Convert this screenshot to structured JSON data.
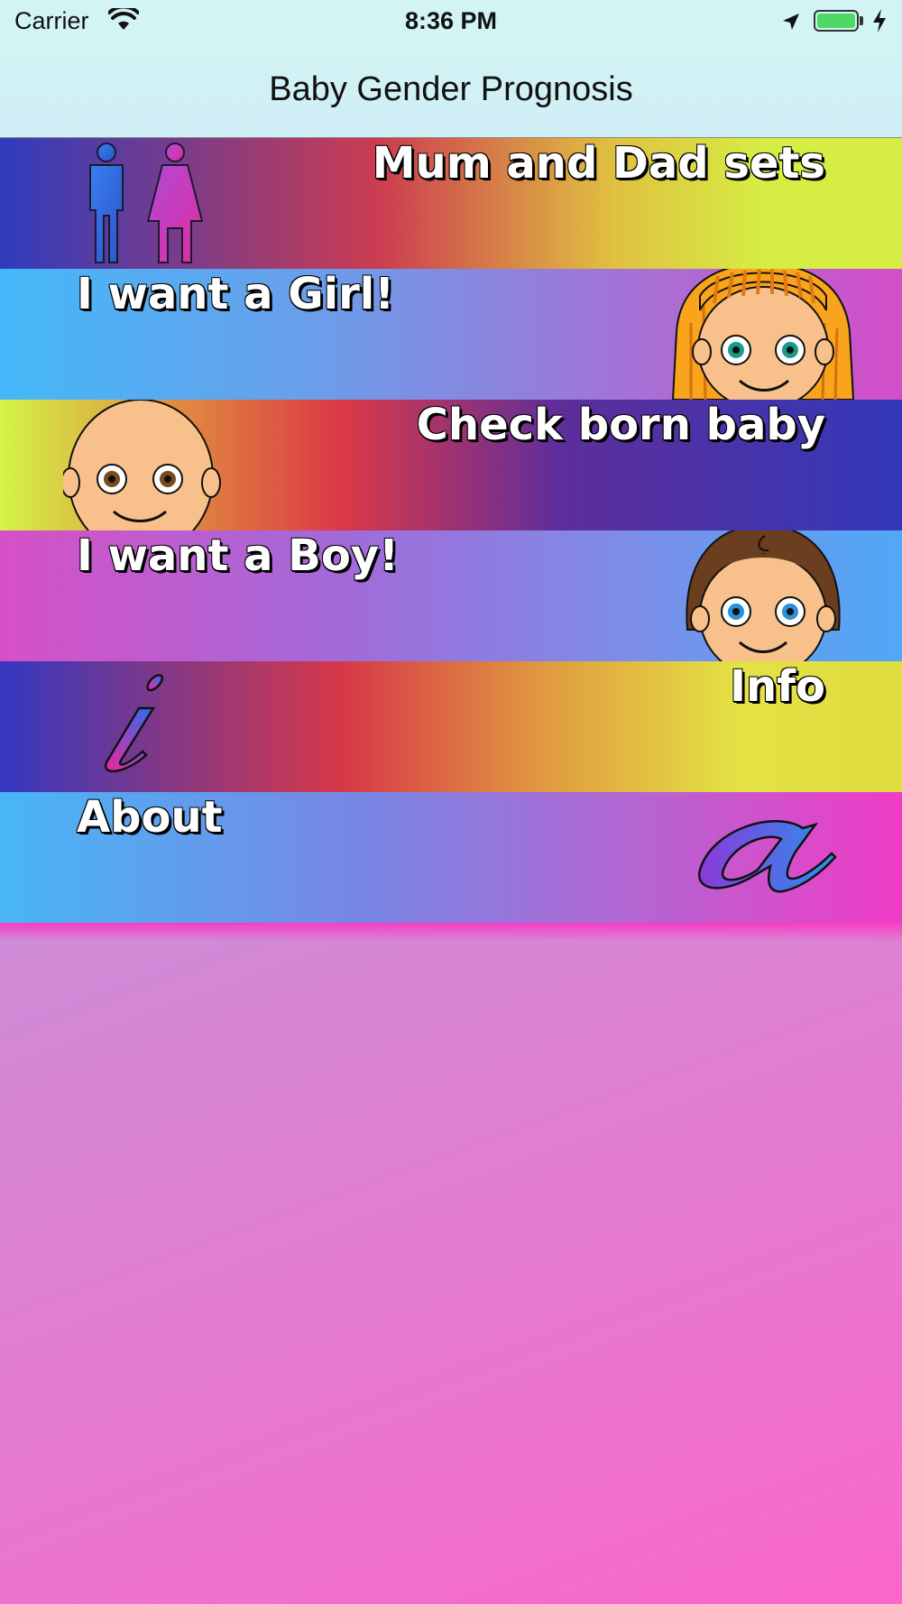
{
  "status_bar": {
    "carrier": "Carrier",
    "time": "8:36 PM",
    "battery_color": "#4cd964"
  },
  "nav": {
    "title": "Baby Gender Prognosis"
  },
  "menu": {
    "items": [
      {
        "label": "Mum and Dad sets",
        "icon": "parents-icon"
      },
      {
        "label": "I want a Girl!",
        "icon": "girl-face-icon"
      },
      {
        "label": "Check born baby",
        "icon": "baby-face-icon"
      },
      {
        "label": "I want a Boy!",
        "icon": "boy-face-icon"
      },
      {
        "label": "Info",
        "icon": "info-letter-icon"
      },
      {
        "label": "About",
        "icon": "about-letter-icon"
      }
    ]
  }
}
